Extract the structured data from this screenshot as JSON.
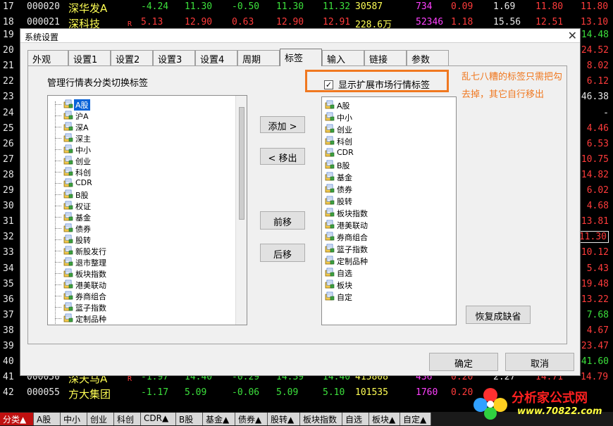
{
  "colors": {
    "up": "#ff3b3b",
    "down": "#3ce03c",
    "accent_orange": "#f07820",
    "selection": "#0a64d8"
  },
  "stock_rows_top": [
    {
      "idx": "17",
      "code": "000020",
      "name": "深华发A",
      "flag": "",
      "chg": "-4.24",
      "price": "11.30",
      "diff": "-0.50",
      "buy": "11.30",
      "sell": "11.32",
      "vol": "30587",
      "cur": "734",
      "pct": "0.09",
      "ratio": "1.69",
      "high": "11.80",
      "right": "11.80"
    },
    {
      "idx": "18",
      "code": "000021",
      "name": "深科技",
      "flag": "R",
      "chg": "5.13",
      "price": "12.90",
      "diff": "0.63",
      "buy": "12.90",
      "sell": "12.91",
      "vol": "228.6万",
      "cur": "52346",
      "pct": "1.18",
      "ratio": "15.56",
      "high": "12.51",
      "right": "13.10"
    }
  ],
  "stock_rows_bottom": [
    {
      "idx": "41",
      "code": "000050",
      "name": "深天马A",
      "flag": "R",
      "chg": "-1.97",
      "price": "14.40",
      "diff": "-0.29",
      "buy": "14.39",
      "sell": "14.40",
      "vol": "415808",
      "cur": "436",
      "pct": "0.20",
      "ratio": "2.27",
      "high": "14.71",
      "right": "14.79"
    },
    {
      "idx": "42",
      "code": "000055",
      "name": "方大集团",
      "flag": "",
      "chg": "-1.17",
      "price": "5.09",
      "diff": "-0.06",
      "buy": "5.09",
      "sell": "5.10",
      "vol": "101535",
      "cur": "1760",
      "pct": "0.20",
      "ratio": "",
      "high": "",
      "right": ""
    }
  ],
  "right_strip": [
    {
      "idx": "19",
      "val": "14.48",
      "dir": "dn"
    },
    {
      "idx": "20",
      "val": "24.52",
      "dir": "up"
    },
    {
      "idx": "21",
      "val": "8.02",
      "dir": "up"
    },
    {
      "idx": "22",
      "val": "6.12",
      "dir": "up"
    },
    {
      "idx": "23",
      "val": "46.38",
      "dir": "wt"
    },
    {
      "idx": "24",
      "val": "-",
      "dir": "wt"
    },
    {
      "idx": "25",
      "val": "4.46",
      "dir": "up"
    },
    {
      "idx": "26",
      "val": "6.53",
      "dir": "up"
    },
    {
      "idx": "27",
      "val": "10.75",
      "dir": "up"
    },
    {
      "idx": "28",
      "val": "14.82",
      "dir": "up"
    },
    {
      "idx": "29",
      "val": "6.02",
      "dir": "up"
    },
    {
      "idx": "30",
      "val": "4.68",
      "dir": "up"
    },
    {
      "idx": "31",
      "val": "13.81",
      "dir": "up"
    },
    {
      "idx": "32",
      "val": "11.30",
      "dir": "up",
      "box": true
    },
    {
      "idx": "33",
      "val": "10.12",
      "dir": "up"
    },
    {
      "idx": "34",
      "val": "5.43",
      "dir": "up"
    },
    {
      "idx": "35",
      "val": "19.48",
      "dir": "up"
    },
    {
      "idx": "36",
      "val": "13.22",
      "dir": "up"
    },
    {
      "idx": "37",
      "val": "7.68",
      "dir": "dn"
    },
    {
      "idx": "38",
      "val": "4.67",
      "dir": "up"
    },
    {
      "idx": "39",
      "val": "23.47",
      "dir": "up"
    },
    {
      "idx": "40",
      "val": "41.60",
      "dir": "dn"
    }
  ],
  "dialog": {
    "title": "系统设置",
    "close_glyph": "✕",
    "tabs": [
      "外观",
      "设置1",
      "设置2",
      "设置3",
      "设置4",
      "周期",
      "标签",
      "输入",
      "链接",
      "参数"
    ],
    "active_tab": "标签",
    "group_label": "管理行情表分类切换标签",
    "checkbox_label": "显示扩展市场行情标签",
    "checkbox_checked": true,
    "checkbox_mark": "✓",
    "annotation_line1": "乱七八糟的标签只需把勾",
    "annotation_line2": "去掉，其它自行移出",
    "left_list": [
      "A股",
      "沪A",
      "深A",
      "深主",
      "中小",
      "创业",
      "科创",
      "CDR",
      "B股",
      "权证",
      "基金",
      "债券",
      "股转",
      "新股发行",
      "退市整理",
      "板块指数",
      "港美联动",
      "券商组合",
      "篮子指数",
      "定制品种"
    ],
    "left_selected": "A股",
    "right_list": [
      "A股",
      "中小",
      "创业",
      "科创",
      "CDR",
      "B股",
      "基金",
      "债券",
      "股转",
      "板块指数",
      "港美联动",
      "券商组合",
      "篮子指数",
      "定制品种",
      "自选",
      "板块",
      "自定"
    ],
    "btn_add": "添加 >",
    "btn_remove": "< 移出",
    "btn_up": "前移",
    "btn_down": "后移",
    "btn_restore": "恢复成缺省",
    "btn_ok": "确定",
    "btn_cancel": "取消"
  },
  "bottom_tabs": [
    "分类▲",
    "A股",
    "中小",
    "创业",
    "科创",
    "CDR▲",
    "B股",
    "基金▲",
    "债券▲",
    "股转▲",
    "板块指数",
    "自选",
    "板块▲",
    "自定▲"
  ],
  "logo": {
    "text": "分析家公式网",
    "url_text": "www.70822.com"
  }
}
